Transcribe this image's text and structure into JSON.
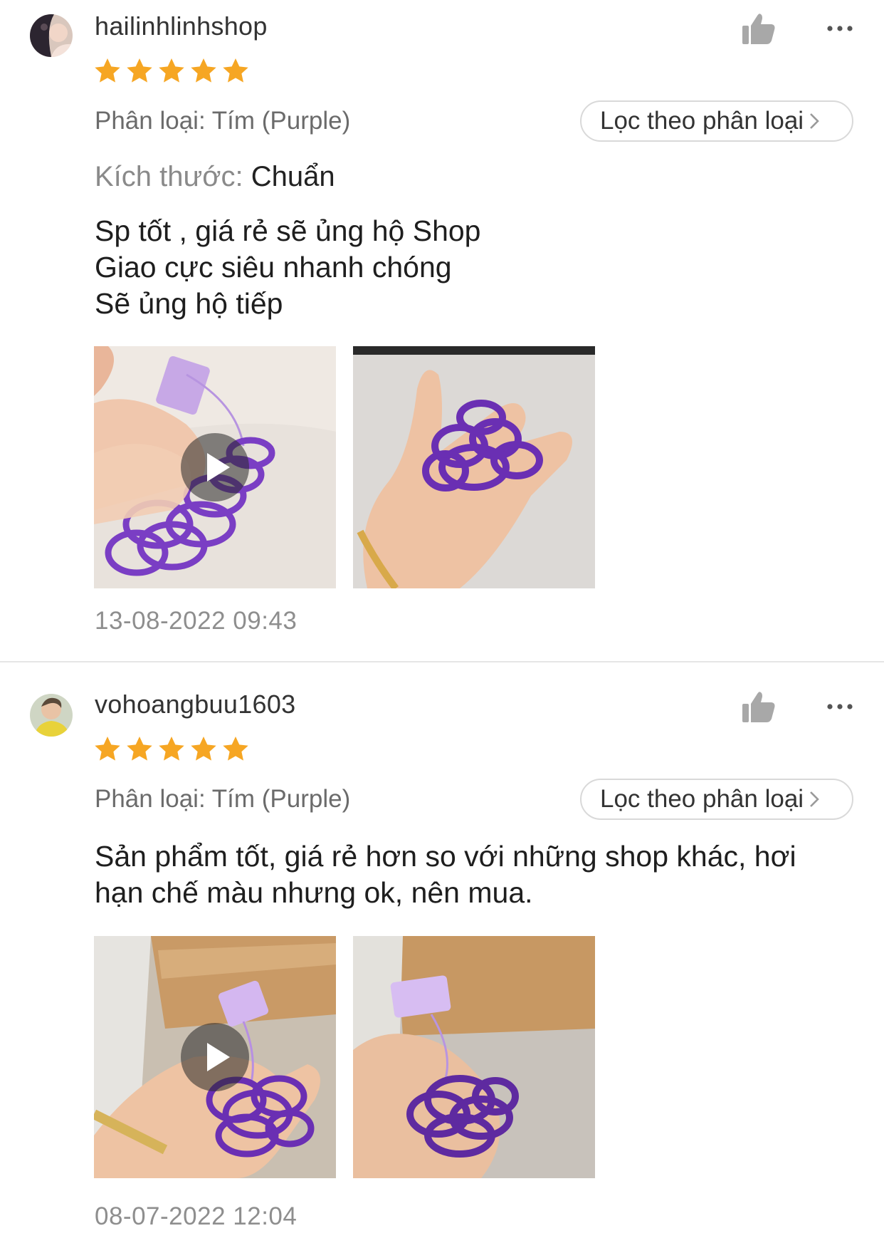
{
  "reviews": [
    {
      "username": "hailinhlinhshop",
      "rating": 5,
      "variant_label": "Phân loại: Tím (Purple)",
      "filter_button": "Lọc theo phân loại",
      "size_key": "Kích thước:",
      "size_value": "Chuẩn",
      "comment": "Sp tốt , giá rẻ sẽ ủng hộ Shop\nGiao cực siêu nhanh chóng\nSẽ ủng hộ tiếp",
      "media": [
        {
          "type": "video",
          "icon": "play-icon"
        },
        {
          "type": "photo"
        }
      ],
      "timestamp": "13-08-2022 09:43"
    },
    {
      "username": "vohoangbuu1603",
      "rating": 5,
      "variant_label": "Phân loại: Tím (Purple)",
      "filter_button": "Lọc theo phân loại",
      "comment": "Sản phẩm tốt, giá rẻ hơn so với những shop khác, hơi hạn chế màu nhưng ok, nên mua.",
      "media": [
        {
          "type": "video",
          "icon": "play-icon"
        },
        {
          "type": "photo"
        }
      ],
      "timestamp": "08-07-2022 12:04"
    }
  ],
  "icons": {
    "like": "thumbs-up-icon",
    "more": "more-dots-icon",
    "star": "star-icon",
    "chevron": "chevron-right-icon"
  },
  "colors": {
    "star": "#f6a623",
    "icon_gray": "#a8a8a8",
    "text_secondary": "#6b6b6b",
    "ring_purple": "#6a2fb3"
  }
}
